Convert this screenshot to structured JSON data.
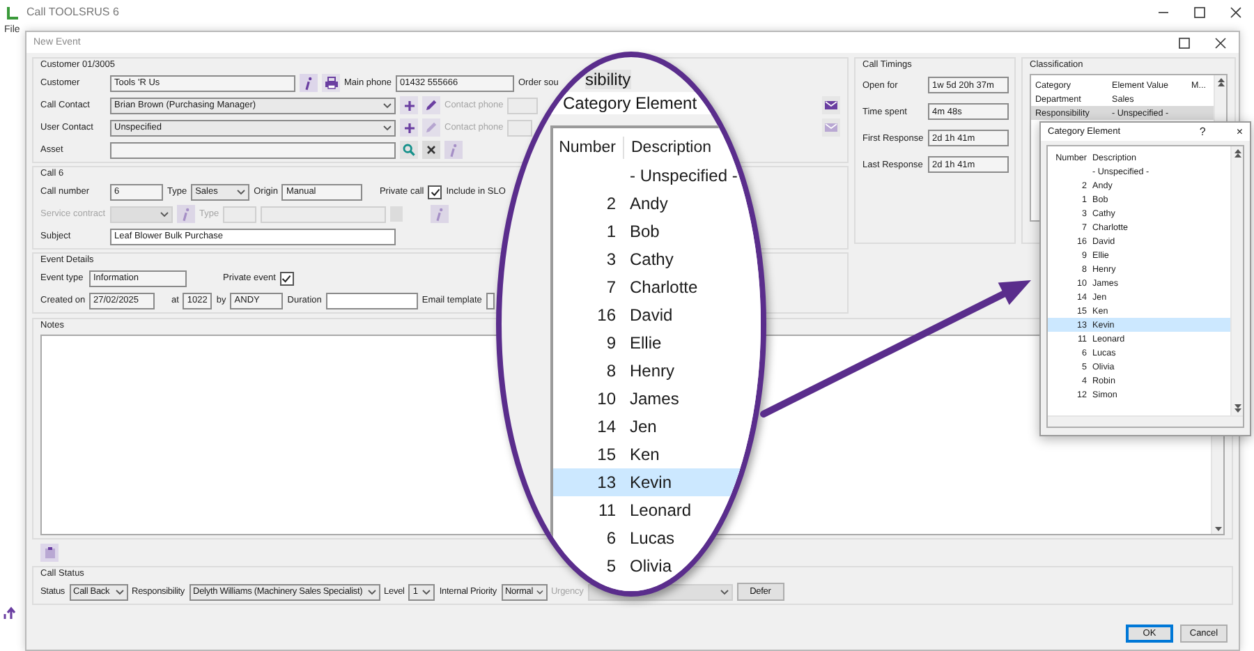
{
  "app": {
    "title": "Call TOOLSRUS 6",
    "menu": [
      "File"
    ]
  },
  "dialog": {
    "title": "New Event"
  },
  "customer_group": {
    "heading": "Customer 01/3005",
    "customer": {
      "label": "Customer",
      "value": "Tools 'R Us"
    },
    "main_phone": {
      "label": "Main phone",
      "value": "01432 555666"
    },
    "order_source": {
      "label": "Order sou"
    },
    "call_contact": {
      "label": "Call Contact",
      "value": "Brian Brown (Purchasing Manager)"
    },
    "call_contact_phone": {
      "label": "Contact phone",
      "disabled": true
    },
    "user_contact": {
      "label": "User Contact",
      "value": "Unspecified"
    },
    "user_contact_phone": {
      "label": "Contact phone",
      "disabled": true
    },
    "asset": {
      "label": "Asset"
    }
  },
  "call_group": {
    "heading": "Call 6",
    "call_number": {
      "label": "Call number",
      "value": "6"
    },
    "type": {
      "label": "Type",
      "value": "Sales"
    },
    "origin": {
      "label": "Origin",
      "value": "Manual"
    },
    "private_call": {
      "label": "Private call",
      "checked": true
    },
    "include_in_slo": {
      "label": "Include in SLO"
    },
    "service_contract": {
      "label": "Service contract",
      "disabled": true
    },
    "service_type": {
      "label": "Type",
      "disabled": true
    },
    "subject": {
      "label": "Subject",
      "value": "Leaf Blower Bulk Purchase"
    }
  },
  "event_group": {
    "heading": "Event Details",
    "event_type": {
      "label": "Event type",
      "value": "Information"
    },
    "private_event": {
      "label": "Private event",
      "checked": true
    },
    "created_on": {
      "label": "Created on",
      "value": "27/02/2025"
    },
    "at": {
      "label": "at",
      "value": "1022"
    },
    "by": {
      "label": "by",
      "value": "ANDY"
    },
    "duration": {
      "label": "Duration"
    },
    "email_template": {
      "label": "Email template"
    }
  },
  "call_timings": {
    "heading": "Call Timings",
    "rows": [
      {
        "label": "Open for",
        "value": "1w 5d 20h 37m"
      },
      {
        "label": "Time spent",
        "value": "4m 48s"
      },
      {
        "label": "First Response",
        "value": "2d 1h 41m"
      },
      {
        "label": "Last Response",
        "value": "2d 1h 41m"
      }
    ]
  },
  "classification": {
    "heading": "Classification",
    "columns": [
      "Category",
      "Element Value",
      "M..."
    ],
    "rows": [
      {
        "cells": [
          "Department",
          "Sales"
        ],
        "selected": false
      },
      {
        "cells": [
          "Responsibility",
          "- Unspecified -"
        ],
        "selected": true
      }
    ]
  },
  "notes": {
    "label": "Notes"
  },
  "call_status": {
    "heading": "Call Status",
    "status": {
      "label": "Status",
      "value": "Call Back"
    },
    "responsibility": {
      "label": "Responsibility",
      "value": "Delyth Williams (Machinery Sales Specialist)"
    },
    "level": {
      "label": "Level",
      "value": "1"
    },
    "internal_priority": {
      "label": "Internal Priority",
      "value": "Normal"
    },
    "urgency": {
      "label": "Urgency",
      "disabled": true
    },
    "defer_button": "Defer"
  },
  "buttons": [
    {
      "label": "OK",
      "default": true
    },
    {
      "label": "Cancel",
      "default": false
    }
  ],
  "magnifier": {
    "combo_text": "sibility",
    "title": "Category Element",
    "columns": [
      "Number",
      "Description"
    ],
    "rows": [
      {
        "description": "- Unspecified -",
        "selected": false
      },
      {
        "number": "2",
        "description": "Andy",
        "selected": false
      },
      {
        "number": "1",
        "description": "Bob",
        "selected": false
      },
      {
        "number": "3",
        "description": "Cathy",
        "selected": false
      },
      {
        "number": "7",
        "description": "Charlotte",
        "selected": false
      },
      {
        "number": "16",
        "description": "David",
        "selected": false
      },
      {
        "number": "9",
        "description": "Ellie",
        "selected": false
      },
      {
        "number": "8",
        "description": "Henry",
        "selected": false
      },
      {
        "number": "10",
        "description": "James",
        "selected": false
      },
      {
        "number": "14",
        "description": "Jen",
        "selected": false
      },
      {
        "number": "15",
        "description": "Ken",
        "selected": false
      },
      {
        "number": "13",
        "description": "Kevin",
        "selected": true
      },
      {
        "number": "11",
        "description": "Leonard",
        "selected": false
      },
      {
        "number": "6",
        "description": "Lucas",
        "selected": false
      },
      {
        "number": "5",
        "description": "Olivia",
        "selected": false
      }
    ]
  },
  "category_dialog": {
    "title": "Category Element",
    "help": "?",
    "close": "×",
    "columns": [
      "Number",
      "Description"
    ],
    "rows": [
      {
        "description": "- Unspecified -",
        "selected": false
      },
      {
        "number": "2",
        "description": "Andy",
        "selected": false
      },
      {
        "number": "1",
        "description": "Bob",
        "selected": false
      },
      {
        "number": "3",
        "description": "Cathy",
        "selected": false
      },
      {
        "number": "7",
        "description": "Charlotte",
        "selected": false
      },
      {
        "number": "16",
        "description": "David",
        "selected": false
      },
      {
        "number": "9",
        "description": "Ellie",
        "selected": false
      },
      {
        "number": "8",
        "description": "Henry",
        "selected": false
      },
      {
        "number": "10",
        "description": "James",
        "selected": false
      },
      {
        "number": "14",
        "description": "Jen",
        "selected": false
      },
      {
        "number": "15",
        "description": "Ken",
        "selected": false
      },
      {
        "number": "13",
        "description": "Kevin",
        "selected": true
      },
      {
        "number": "11",
        "description": "Leonard",
        "selected": false
      },
      {
        "number": "6",
        "description": "Lucas",
        "selected": false
      },
      {
        "number": "5",
        "description": "Olivia",
        "selected": false
      },
      {
        "number": "4",
        "description": "Robin",
        "selected": false
      },
      {
        "number": "12",
        "description": "Simon",
        "selected": false
      }
    ]
  }
}
